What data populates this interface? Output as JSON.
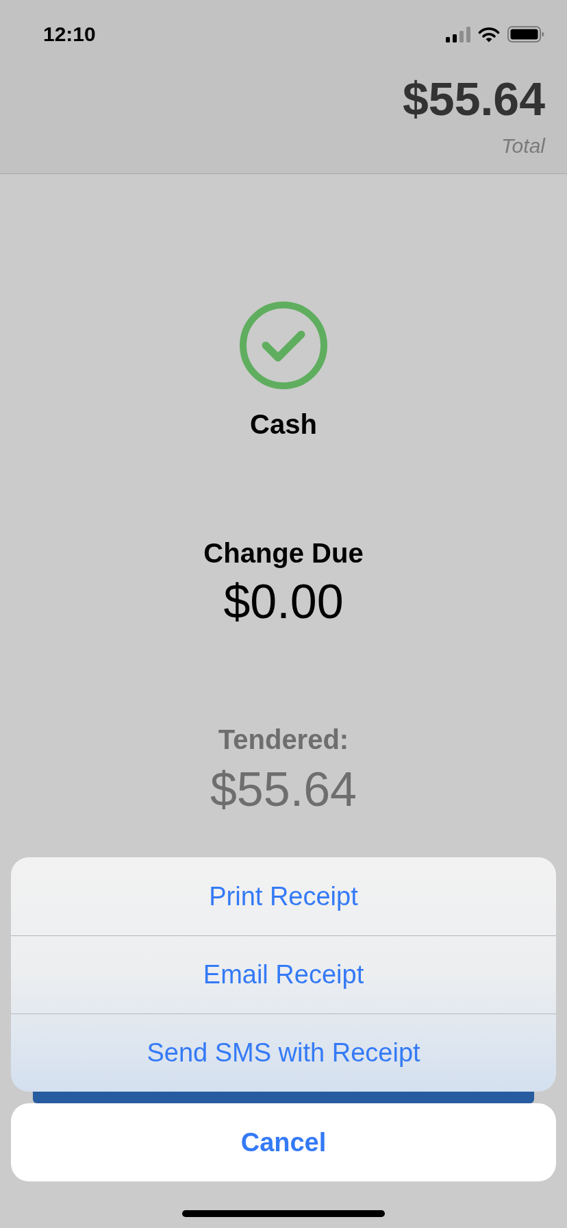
{
  "status_bar": {
    "time": "12:10"
  },
  "header": {
    "total": "$55.64",
    "total_label": "Total"
  },
  "payment": {
    "method": "Cash"
  },
  "change": {
    "label": "Change Due",
    "amount": "$0.00"
  },
  "tendered": {
    "label": "Tendered:",
    "amount": "$55.64"
  },
  "action_sheet": {
    "actions": [
      "Print Receipt",
      "Email Receipt",
      "Send SMS with Receipt"
    ],
    "cancel": "Cancel"
  }
}
